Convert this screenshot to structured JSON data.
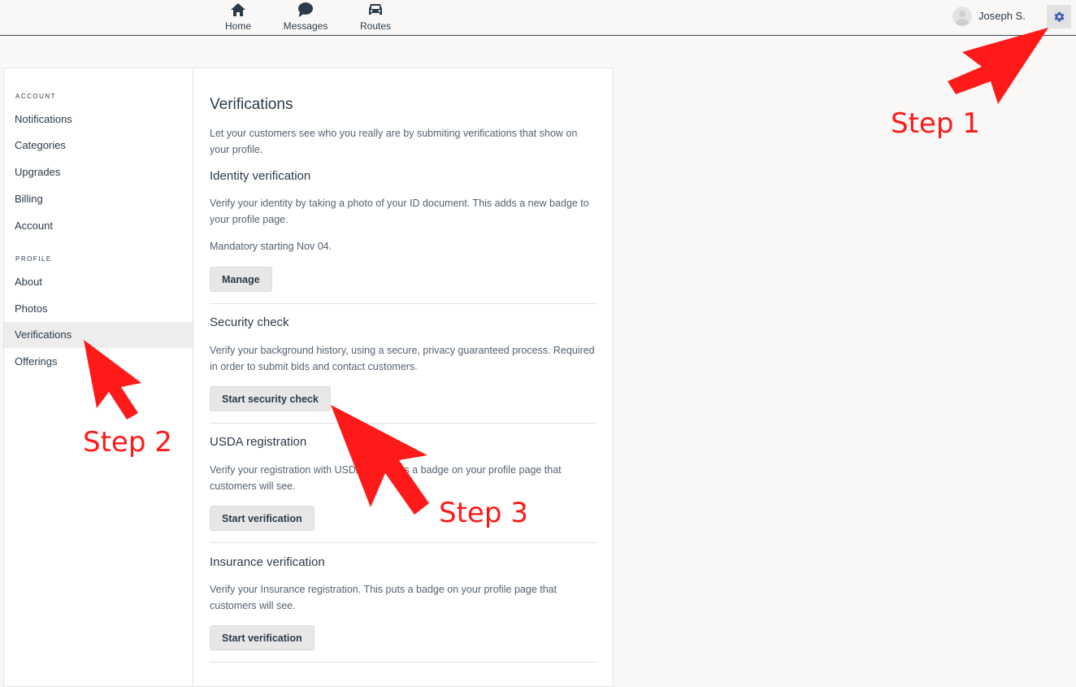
{
  "nav": {
    "items": [
      {
        "label": "Home",
        "icon": "home-icon"
      },
      {
        "label": "Messages",
        "icon": "chat-bubble-icon"
      },
      {
        "label": "Routes",
        "icon": "car-icon"
      }
    ],
    "user_name": "Joseph S.",
    "settings_icon": "gear-icon"
  },
  "sidebar": {
    "account_heading": "ACCOUNT",
    "account_items": [
      "Notifications",
      "Categories",
      "Upgrades",
      "Billing",
      "Account"
    ],
    "profile_heading": "PROFILE",
    "profile_items": [
      "About",
      "Photos",
      "Verifications",
      "Offerings"
    ],
    "active_item": "Verifications"
  },
  "main": {
    "title": "Verifications",
    "intro": "Let your customers see who you really are by submiting verifications that show on your profile.",
    "sections": [
      {
        "title": "Identity verification",
        "desc": "Verify your identity by taking a photo of your ID document. This adds a new badge to your profile page.",
        "note": "Mandatory starting Nov 04.",
        "button": "Manage"
      },
      {
        "title": "Security check",
        "desc": "Verify your background history, using a secure, privacy guaranteed process. Required in order to submit bids and contact customers.",
        "button": "Start security check"
      },
      {
        "title": "USDA registration",
        "desc": "Verify your registration with USDA. This puts a badge on your profile page that customers will see.",
        "button": "Start verification"
      },
      {
        "title": "Insurance verification",
        "desc": "Verify your Insurance registration. This puts a badge on your profile page that customers will see.",
        "button": "Start verification"
      }
    ]
  },
  "annotations": {
    "step1": "Step 1",
    "step2": "Step 2",
    "step3": "Step 3",
    "arrow_color": "#ff1a1a"
  },
  "colors": {
    "accent": "#3b5bb5",
    "text": "#2b3a4a",
    "muted": "#556270",
    "active_bg": "#ededed"
  }
}
